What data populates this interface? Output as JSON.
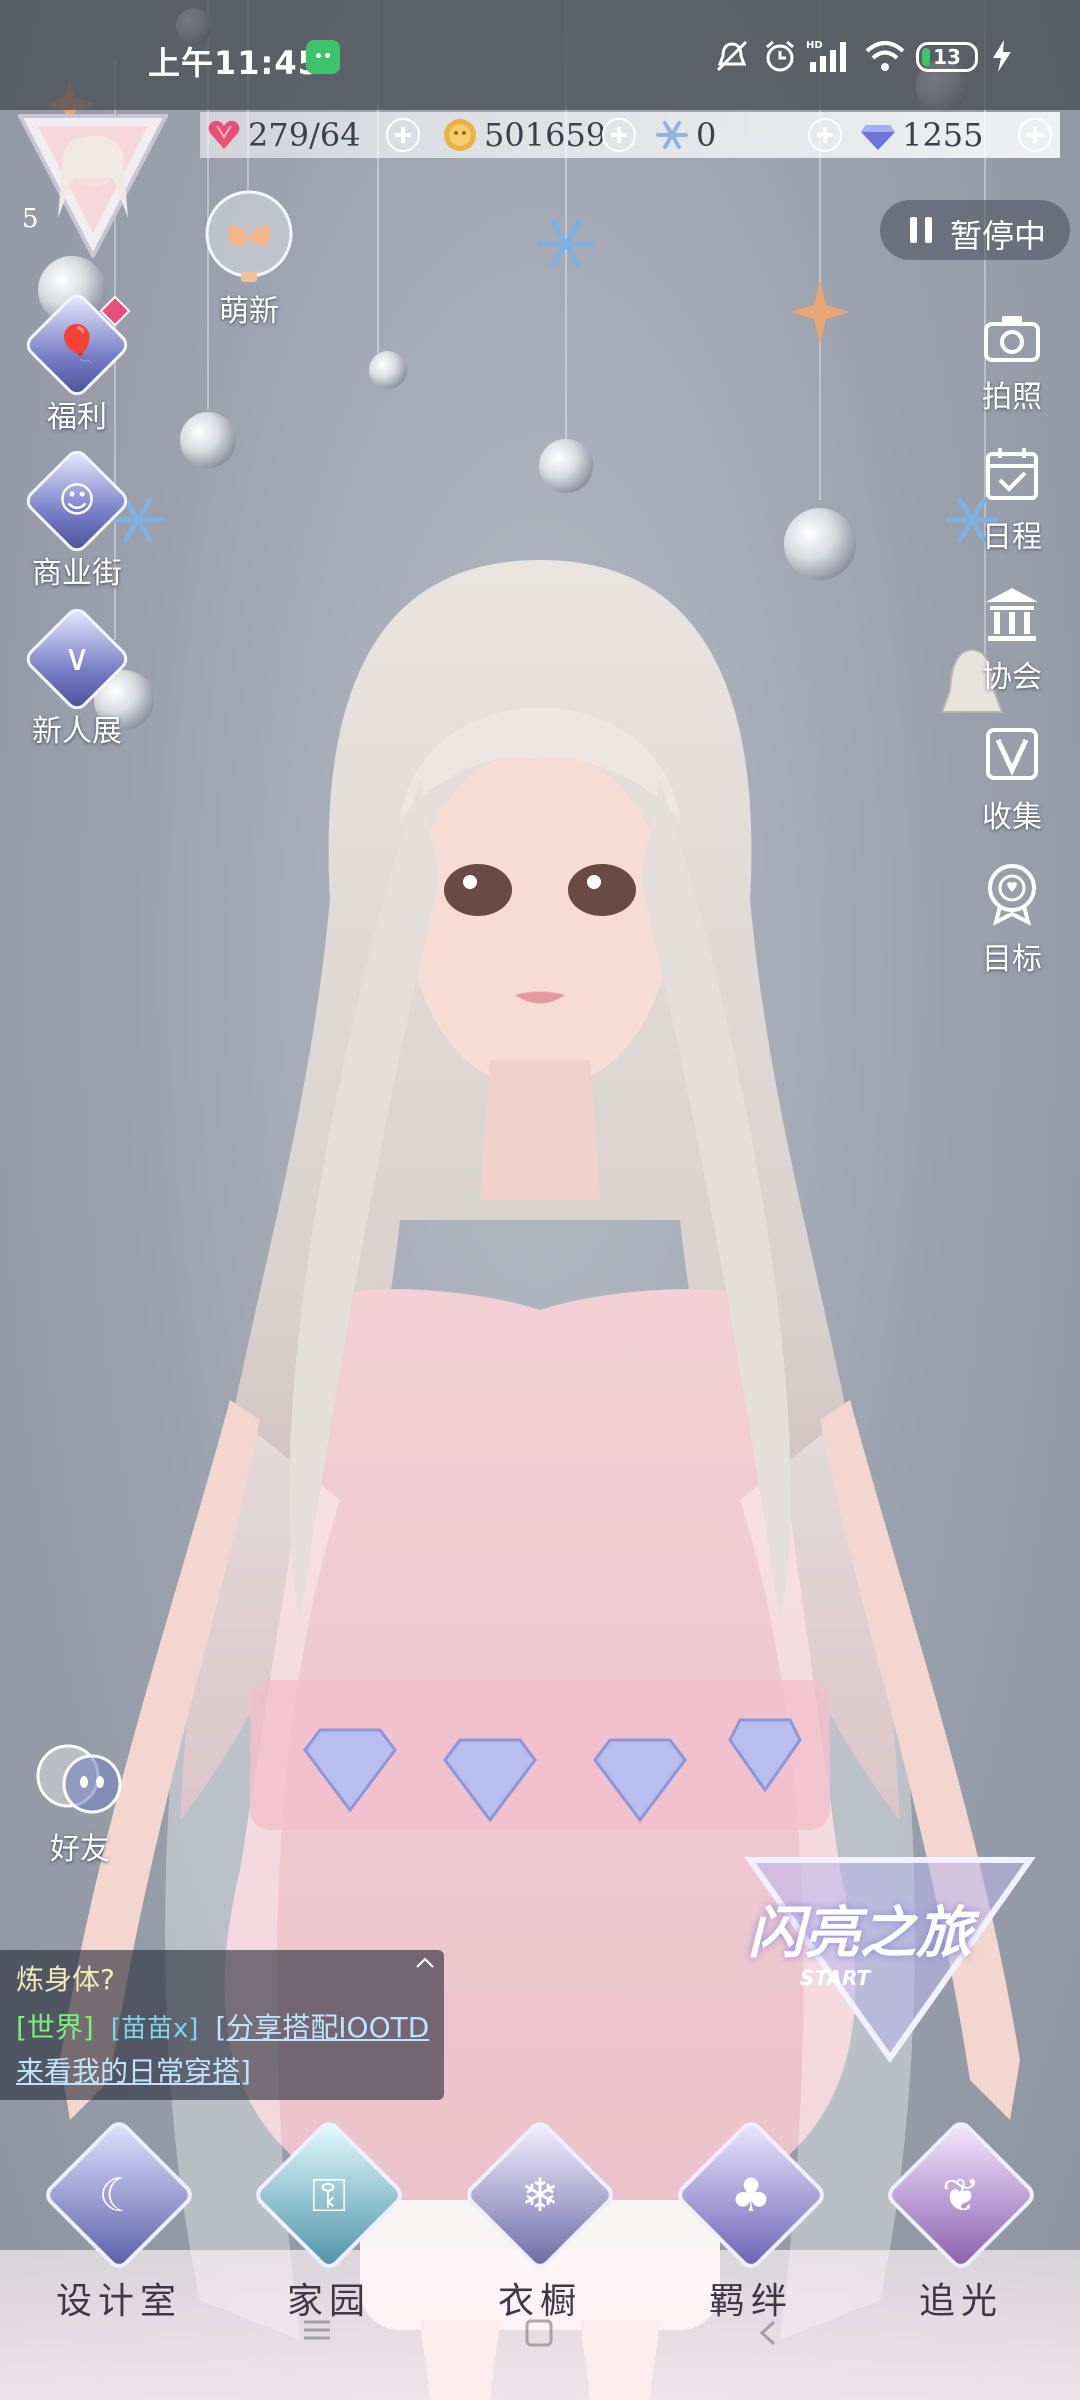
{
  "status_bar": {
    "time": "上午11:45",
    "battery": "13"
  },
  "currencies": [
    {
      "name": "stamina",
      "icon": "heart-gem-icon",
      "value": "279/64"
    },
    {
      "name": "gold",
      "icon": "coin-icon",
      "value": "501659"
    },
    {
      "name": "snow-crystal",
      "icon": "snowflake-icon",
      "value": "0"
    },
    {
      "name": "diamond",
      "icon": "diamond-icon",
      "value": "1255"
    }
  ],
  "avatar": {
    "level": "5"
  },
  "left_menu": [
    {
      "label": "萌新",
      "icon": "butterfly-bubble-icon"
    },
    {
      "label": "福利",
      "icon": "balloon-icon"
    },
    {
      "label": "商业街",
      "icon": "shop-bag-icon"
    },
    {
      "label": "新人展",
      "icon": "crown-v-icon"
    }
  ],
  "right_menu": {
    "pause": "暂停中",
    "items": [
      {
        "label": "拍照",
        "icon": "camera-icon"
      },
      {
        "label": "日程",
        "icon": "calendar-check-icon"
      },
      {
        "label": "协会",
        "icon": "guild-hall-icon"
      },
      {
        "label": "收集",
        "icon": "collect-v-icon"
      },
      {
        "label": "目标",
        "icon": "target-badge-icon"
      }
    ]
  },
  "friends": {
    "label": "好友"
  },
  "chat": {
    "line1": "炼身体?",
    "channel": "[世界]",
    "user": "[苗苗x]",
    "share": "[分享搭配IOOTD",
    "line3": "来看我的日常穿搭]"
  },
  "banner": {
    "title": "闪亮之旅",
    "subtitle": "START"
  },
  "bottom_nav": [
    {
      "label": "设计室",
      "icon": "moon-icon"
    },
    {
      "label": "家园",
      "icon": "key-icon"
    },
    {
      "label": "衣橱",
      "icon": "crystal-flower-icon"
    },
    {
      "label": "羁绊",
      "icon": "clover-icon"
    },
    {
      "label": "追光",
      "icon": "butterfly-icon"
    }
  ],
  "colors": {
    "background": "#9aa1ad",
    "stamina": "#e8507a",
    "gold": "#e8b247",
    "diamond": "#6b74d8",
    "chat_channel": "#7cf07a",
    "chat_link": "#bde3ff"
  }
}
